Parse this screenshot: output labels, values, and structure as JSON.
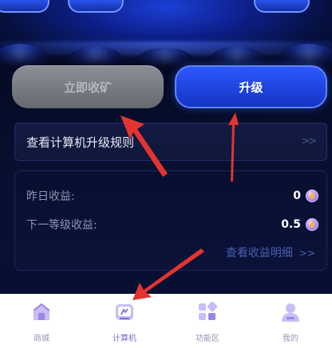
{
  "actions": {
    "collect_label": "立即收矿",
    "upgrade_label": "升级"
  },
  "rules": {
    "label": "查看计算机升级规则",
    "arrow": ">>"
  },
  "earnings": {
    "yesterday_label": "昨日收益:",
    "yesterday_value": "0",
    "next_level_label": "下一等级收益:",
    "next_level_value": "0.5",
    "details_link": "查看收益明细",
    "details_arrow": ">>"
  },
  "tabbar": {
    "items": [
      {
        "label": "商城",
        "icon": "shop-icon"
      },
      {
        "label": "计算机",
        "icon": "computer-icon",
        "active": true
      },
      {
        "label": "功能区",
        "icon": "function-grid-icon"
      },
      {
        "label": "我的",
        "icon": "profile-icon"
      }
    ]
  },
  "colors": {
    "accent_blue": "#1f45e6",
    "annotation_red": "#e3342f",
    "tab_active": "#7f6bd6"
  }
}
